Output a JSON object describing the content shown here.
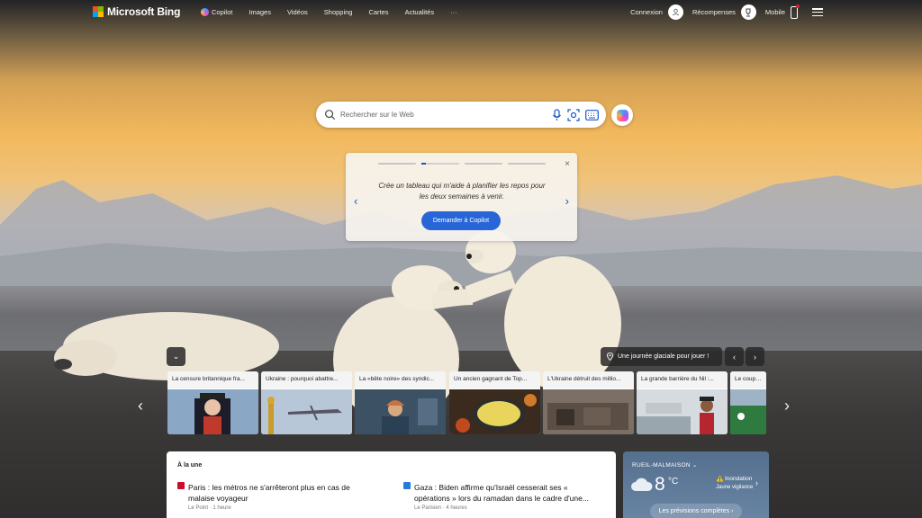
{
  "header": {
    "logo_text": "Microsoft Bing",
    "nav": [
      {
        "label": "Copilot",
        "icon": "copilot-icon"
      },
      {
        "label": "Images"
      },
      {
        "label": "Vidéos"
      },
      {
        "label": "Shopping"
      },
      {
        "label": "Cartes"
      },
      {
        "label": "Actualités"
      },
      {
        "label": "···"
      }
    ],
    "signin_label": "Connexion",
    "rewards_label": "Récompenses",
    "mobile_label": "Mobile"
  },
  "search": {
    "placeholder": "Rechercher sur le Web"
  },
  "copilot_card": {
    "text": "Crée un tableau qui m'aide à planifier les repos pour les deux semaines à venir.",
    "button_label": "Demander à Copilot",
    "close": "×",
    "prev": "‹",
    "next": "›"
  },
  "carousel": {
    "location_label": "Une journée glaciale pour jouer !",
    "cards": [
      {
        "title": "La censure britannique fra..."
      },
      {
        "title": "Ukraine : pourquoi abattre..."
      },
      {
        "title": "La «bête noire» des syndic..."
      },
      {
        "title": "Un ancien gagnant de Top..."
      },
      {
        "title": "L'Ukraine détruit des millio..."
      },
      {
        "title": "La grande barrière du Nil :..."
      },
      {
        "title": "Le coup de..."
      }
    ]
  },
  "news": {
    "heading": "À la une",
    "items": [
      {
        "title": "Paris : les métros ne s'arrêteront plus en cas de malaise voyageur",
        "meta": "Le Point · 1 heure",
        "icon_color": "#c8102e"
      },
      {
        "title": "Gaza : Biden affirme qu'Israël cesserait ses « opérations » lors du ramadan dans le cadre d'une...",
        "meta": "Le Parisien · 4 heures",
        "icon_color": "#2a7bd8"
      }
    ]
  },
  "weather": {
    "location": "RUEIL-MALMAISON",
    "temp": "8",
    "unit": "°C",
    "alert_title": "Inondation",
    "alert_sub": "Jaune vigilance",
    "forecast_label": "Les prévisions complètes ›"
  }
}
